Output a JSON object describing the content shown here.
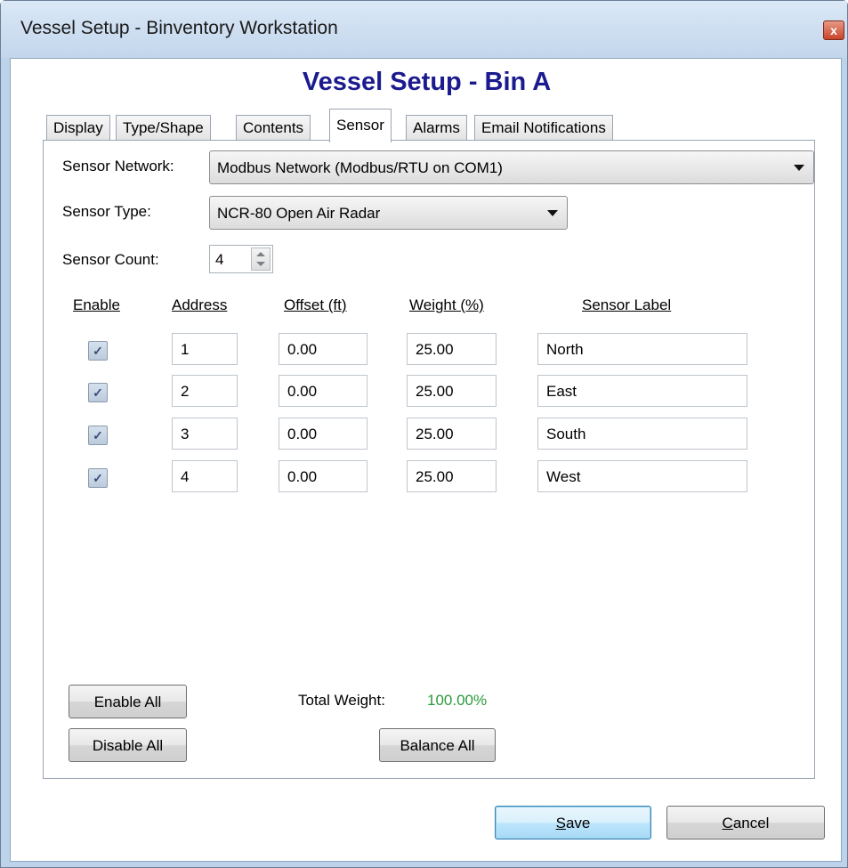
{
  "window": {
    "title": "Vessel Setup - Binventory Workstation",
    "close_glyph": "x"
  },
  "heading": "Vessel Setup - Bin A",
  "tabs": [
    {
      "label": "Display",
      "active": false
    },
    {
      "label": "Type/Shape",
      "active": false
    },
    {
      "label": "Contents",
      "active": false
    },
    {
      "label": "Sensor",
      "active": true
    },
    {
      "label": "Alarms",
      "active": false
    },
    {
      "label": "Email Notifications",
      "active": false
    }
  ],
  "sensor": {
    "network_label": "Sensor Network:",
    "network_value": "Modbus Network (Modbus/RTU on COM1)",
    "type_label": "Sensor Type:",
    "type_value": "NCR-80 Open Air Radar",
    "count_label": "Sensor Count:",
    "count_value": "4"
  },
  "table": {
    "headers": {
      "enable": "Enable",
      "address": "Address",
      "offset": "Offset (ft)",
      "weight": "Weight (%)",
      "label": "Sensor Label"
    },
    "rows": [
      {
        "enabled": true,
        "address": "1",
        "offset": "0.00",
        "weight": "25.00",
        "label": "North"
      },
      {
        "enabled": true,
        "address": "2",
        "offset": "0.00",
        "weight": "25.00",
        "label": "East"
      },
      {
        "enabled": true,
        "address": "3",
        "offset": "0.00",
        "weight": "25.00",
        "label": "South"
      },
      {
        "enabled": true,
        "address": "4",
        "offset": "0.00",
        "weight": "25.00",
        "label": "West"
      }
    ]
  },
  "actions": {
    "enable_all": "Enable All",
    "disable_all": "Disable All",
    "total_weight_label": "Total Weight:",
    "total_weight_value": "100.00%",
    "balance_all": "Balance All"
  },
  "footer": {
    "save_first": "S",
    "save_rest": "ave",
    "cancel_first": "C",
    "cancel_rest": "ancel"
  },
  "colors": {
    "heading": "#1b1b8f",
    "total_weight": "#2a9a3a",
    "titlebar": "#c2d6ec"
  },
  "icons": {
    "check": "✓",
    "dropdown": "chevron-down-icon",
    "spinner": "spin-icon"
  }
}
